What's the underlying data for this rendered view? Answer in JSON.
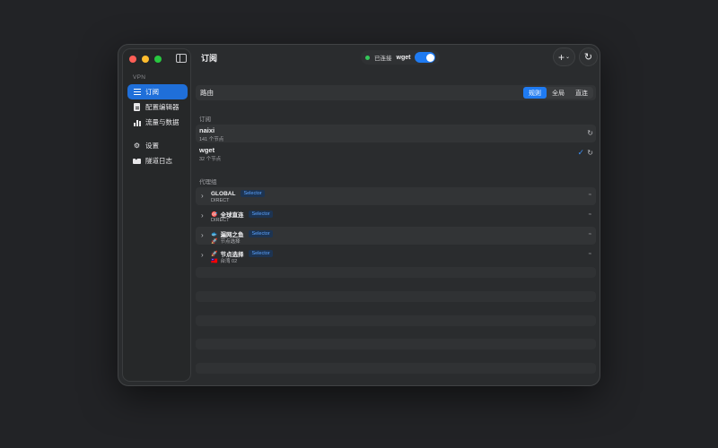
{
  "sidebar": {
    "section_label": "VPN",
    "items": [
      {
        "label": "订阅",
        "icon": "list-icon",
        "active": true
      },
      {
        "label": "配置编辑器",
        "icon": "document-icon",
        "active": false
      },
      {
        "label": "流量与数据",
        "icon": "bar-chart-icon",
        "active": false
      },
      {
        "label": "设置",
        "icon": "gear-icon",
        "active": false
      },
      {
        "label": "隧道日志",
        "icon": "envelope-icon",
        "active": false
      }
    ]
  },
  "toolbar": {
    "title": "订阅",
    "status_text": "已连接",
    "profile_name": "wget",
    "connected": true,
    "add_symbol": "+",
    "add_chevron": "⌄",
    "refresh_symbol": "↻"
  },
  "route": {
    "label": "路由",
    "modes": [
      "规则",
      "全局",
      "直连"
    ],
    "selected": "规则"
  },
  "subscriptions": {
    "heading": "订阅",
    "items": [
      {
        "name": "naixi",
        "count": "141 个节点",
        "selected": false
      },
      {
        "name": "wget",
        "count": "32 个节点",
        "selected": true
      }
    ]
  },
  "proxy_groups": {
    "heading": "代理组",
    "items": [
      {
        "emoji": "",
        "name": "GLOBAL",
        "type": "Selector",
        "sub_emoji": "",
        "current": "DIRECT"
      },
      {
        "emoji": "🎯",
        "name": "全球直连",
        "type": "Selector",
        "sub_emoji": "",
        "current": "DIRECT"
      },
      {
        "emoji": "🐟",
        "name": "漏网之鱼",
        "type": "Selector",
        "sub_emoji": "🚀",
        "current": "节点选择"
      },
      {
        "emoji": "🚀",
        "name": "节点选择",
        "type": "Selector",
        "sub_emoji": "🇹🇼",
        "current": "台湾 02"
      }
    ]
  },
  "colors": {
    "accent": "#1f7bf2",
    "connected": "#34c759",
    "tag_text": "#5ba3ff"
  }
}
